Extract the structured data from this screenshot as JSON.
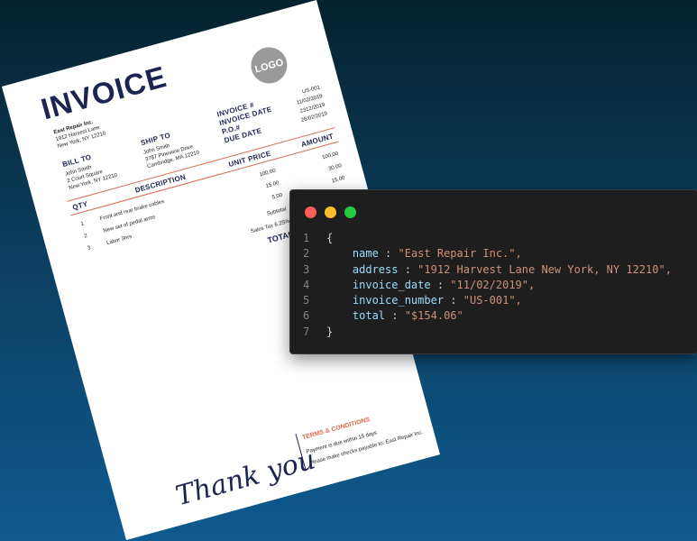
{
  "invoice": {
    "title": "INVOICE",
    "logo_text": "LOGO",
    "company_name": "East Repair Inc.",
    "company_street": "1912 Harvest Lane",
    "company_city": "New York, NY 12210",
    "bill_to_label": "BILL TO",
    "bill_to_name": "John Smith",
    "bill_to_street": "2 Court Square",
    "bill_to_city": "New York, NY 12210",
    "ship_to_label": "SHIP TO",
    "ship_to_name": "John Smith",
    "ship_to_street": "3787 Pineview Drive",
    "ship_to_city": "Cambridge, MA 12210",
    "meta_labels": [
      "INVOICE #",
      "INVOICE DATE",
      "P.O.#",
      "DUE DATE"
    ],
    "meta_values": [
      "US-001",
      "11/02/2019",
      "2312/2019",
      "26/02/2019"
    ],
    "col_qty": "QTY",
    "col_description": "DESCRIPTION",
    "col_unit_price": "UNIT PRICE",
    "col_amount": "AMOUNT",
    "items": [
      {
        "qty": "1",
        "description": "Front and rear brake cables",
        "unit_price": "100.00",
        "amount": "100.00"
      },
      {
        "qty": "2",
        "description": "New set of pedal arms",
        "unit_price": "15.00",
        "amount": "30.00"
      },
      {
        "qty": "3",
        "description": "Labor 3hrs",
        "unit_price": "5.00",
        "amount": "15.00"
      }
    ],
    "subtotal_label": "Subtotal",
    "sales_tax_label": "Sales Tax 6.25%",
    "total_label": "TOTAL",
    "terms_title": "TERMS & CONDITIONS",
    "terms_line1": "Payment is due within 15 days",
    "terms_line2": "Please make checks payable to: East Repair Inc.",
    "thank_you": "Thank you"
  },
  "code_window": {
    "dot_colors": [
      "#ff5f56",
      "#ffbd2e",
      "#27c93f"
    ],
    "lines": [
      {
        "number": "1",
        "key": "",
        "value": "",
        "text": "{"
      },
      {
        "number": "2",
        "key": "name",
        "value": "\"East Repair Inc.\",",
        "text": ""
      },
      {
        "number": "3",
        "key": "address",
        "value": "\"1912 Harvest Lane New York, NY 12210\",",
        "text": ""
      },
      {
        "number": "4",
        "key": "invoice_date",
        "value": "\"11/02/2019\",",
        "text": ""
      },
      {
        "number": "5",
        "key": "invoice_number",
        "value": "\"US-001\",",
        "text": ""
      },
      {
        "number": "6",
        "key": "total",
        "value": "\"$154.06\"",
        "text": ""
      },
      {
        "number": "7",
        "key": "",
        "value": "",
        "text": "}"
      }
    ]
  }
}
